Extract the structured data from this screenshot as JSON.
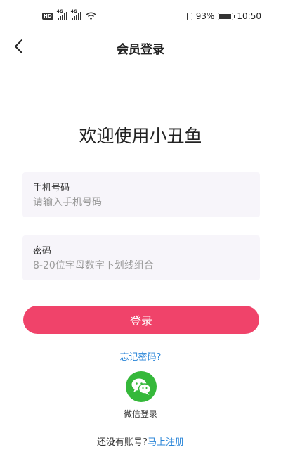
{
  "status_bar": {
    "network_badge": "HD",
    "signal_label_1": "4G",
    "signal_label_2": "4G",
    "battery": "93%",
    "time": "10:50"
  },
  "header": {
    "title": "会员登录"
  },
  "welcome": "欢迎使用小丑鱼",
  "phone_field": {
    "label": "手机号码",
    "placeholder": "请输入手机号码"
  },
  "password_field": {
    "label": "密码",
    "placeholder": "8-20位字母数字下划线组合"
  },
  "login_button": "登录",
  "forgot_password": "忘记密码?",
  "wechat": {
    "label": "微信登录",
    "icon": "wechat-icon",
    "color": "#35b83a"
  },
  "register": {
    "prompt": "还没有账号?",
    "link": "马上注册"
  },
  "colors": {
    "primary": "#f0436a",
    "link": "#2b86d8",
    "field_bg": "#f7f5fa"
  }
}
